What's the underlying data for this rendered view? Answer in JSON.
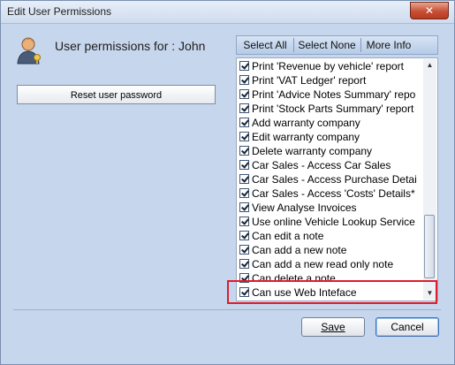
{
  "window": {
    "title": "Edit User Permissions",
    "close_glyph": "✕"
  },
  "header": {
    "user_label": "User permissions for : John",
    "icon": "user-key-icon"
  },
  "reset_button": {
    "label": "Reset user password"
  },
  "toolbar": {
    "select_all": "Select All",
    "select_none": "Select None",
    "more_info": "More Info"
  },
  "permissions": [
    {
      "label": "Print 'Revenue by vehicle' report",
      "checked": true
    },
    {
      "label": "Print 'VAT Ledger' report",
      "checked": true
    },
    {
      "label": "Print 'Advice Notes Summary' repo",
      "checked": true
    },
    {
      "label": "Print 'Stock Parts Summary' report",
      "checked": true
    },
    {
      "label": "Add warranty company",
      "checked": true
    },
    {
      "label": "Edit warranty company",
      "checked": true
    },
    {
      "label": "Delete warranty company",
      "checked": true
    },
    {
      "label": "Car Sales - Access Car Sales",
      "checked": true
    },
    {
      "label": "Car Sales - Access Purchase Detai",
      "checked": true
    },
    {
      "label": "Car Sales - Access 'Costs' Details*",
      "checked": true
    },
    {
      "label": "View Analyse Invoices",
      "checked": true
    },
    {
      "label": "Use online Vehicle Lookup Service",
      "checked": true
    },
    {
      "label": "Can edit a note",
      "checked": true
    },
    {
      "label": "Can add a new note",
      "checked": true
    },
    {
      "label": "Can add a new read only note",
      "checked": true
    },
    {
      "label": "Can delete a note",
      "checked": true
    },
    {
      "label": "Can use Web Inteface",
      "checked": true
    }
  ],
  "buttons": {
    "save": "Save",
    "cancel": "Cancel"
  },
  "colors": {
    "highlight": "#e11b2a",
    "window_bg": "#c6d6ec"
  }
}
